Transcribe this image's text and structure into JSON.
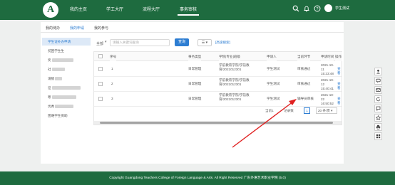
{
  "nav": {
    "items": [
      "我的主页",
      "学工大厅",
      "流程大厅",
      "事务审核"
    ],
    "active_index": 3,
    "user_name": "学生测试"
  },
  "tabs": [
    "我的待办",
    "我的申请",
    "我的参与"
  ],
  "active_tab": 1,
  "sidebar": {
    "items": [
      "学生证补办申请",
      "贫困学生生",
      "奖",
      "社",
      "请销",
      "征",
      "寒",
      "优秀",
      "困难学生资助"
    ]
  },
  "filter": {
    "label": "全部",
    "search_placeholder": "请输入关键词查询",
    "search_btn": "查询",
    "view_btn": "☰ ▾",
    "reset_link": "[高级搜索]"
  },
  "table": {
    "headers": [
      "序号",
      "事务类型",
      "学院|专业|班级",
      "申请人",
      "当前环节",
      "申请时间",
      "操作"
    ],
    "rows": [
      {
        "index": "1",
        "type": "日常管理",
        "class": "学前教育学院/学前教育/2021012301",
        "applicant": "学生测试",
        "step": "审核通过",
        "time": "2021-10-11 15:23:48",
        "action": "查看"
      },
      {
        "index": "2",
        "type": "日常管理",
        "class": "学前教育学院/学前教育/2021012301",
        "applicant": "学生测试",
        "step": "审核通过",
        "time": "2021-10-12 15:40:41",
        "action": "查看"
      },
      {
        "index": "3",
        "type": "日常管理",
        "class": "学前教育学院/学前教育/2021012301",
        "applicant": "学生测试",
        "step": "辅导员审核",
        "time": "2021-10-22 16:50:52",
        "action": "查看"
      }
    ]
  },
  "pager": {
    "prefix": "当前1",
    "suffix": "记录数",
    "page": "1",
    "page_size": "20 条/页 ▾"
  },
  "toolbar": [
    "user-icon",
    "chat-icon",
    "mail-icon",
    "refresh-icon",
    "feedback-icon",
    "star-icon",
    "print-icon",
    "grid-icon"
  ],
  "footer": "Copyright Guangdong Teachers College of Foreign Language & Arts. All Right Reserved 广东外语艺术职业学院 (5.0)",
  "colors": {
    "brand": "#1e6b3f",
    "accent": "#2d7dd2",
    "annotation": "#e02020"
  }
}
